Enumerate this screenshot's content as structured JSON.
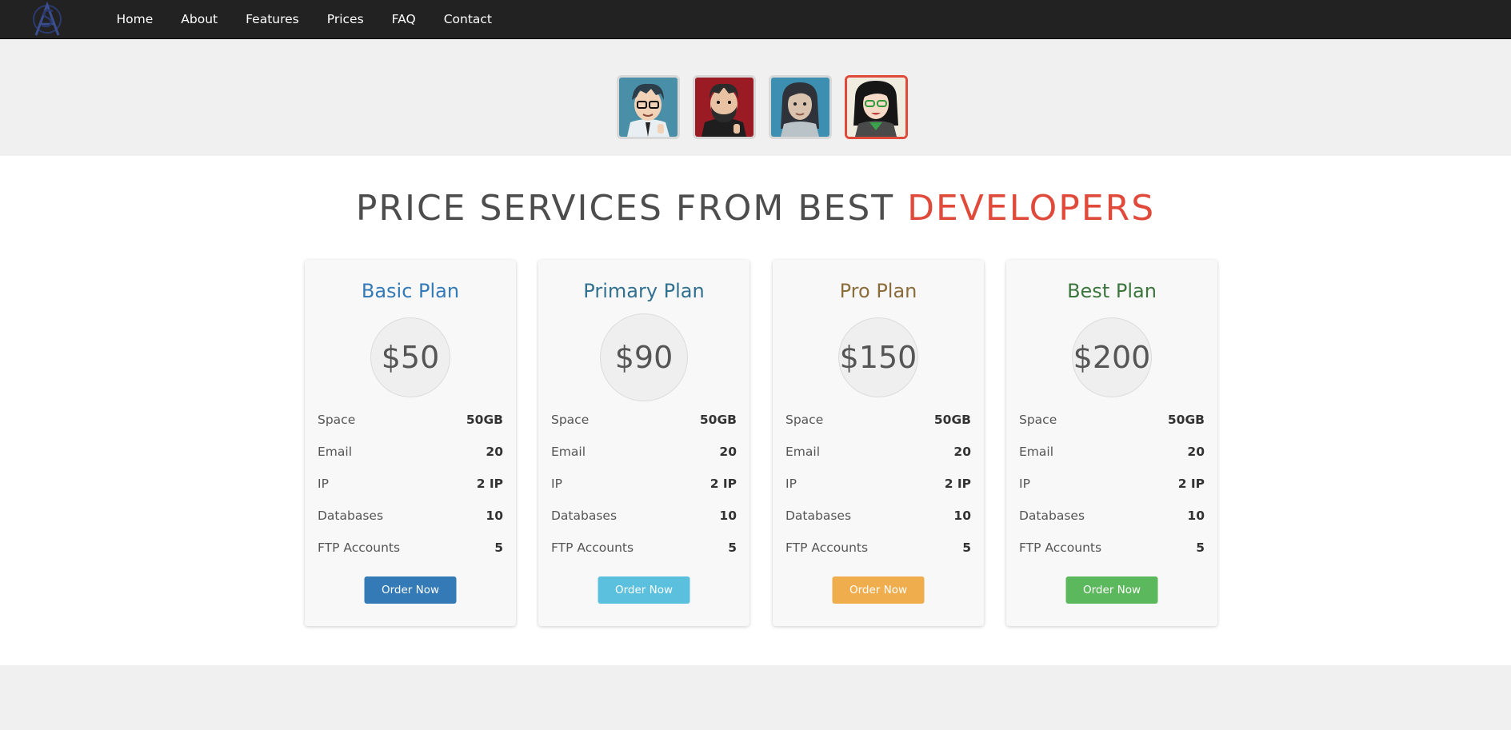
{
  "nav": {
    "items": [
      {
        "label": "Home"
      },
      {
        "label": "About"
      },
      {
        "label": "Features"
      },
      {
        "label": "Prices"
      },
      {
        "label": "FAQ"
      },
      {
        "label": "Contact"
      }
    ]
  },
  "team": {
    "active_index": 3,
    "accent_color": "#e04a3a"
  },
  "prices": {
    "title_main": "PRICE SERVICES FROM BEST ",
    "title_accent": "DEVELOPERS",
    "plans": [
      {
        "name": "Basic Plan",
        "price": "$50",
        "name_color": "#337ab7",
        "button_color": "#337ab7",
        "features": [
          {
            "label": "Space",
            "value": "50GB"
          },
          {
            "label": "Email",
            "value": "20"
          },
          {
            "label": "IP",
            "value": "2 IP"
          },
          {
            "label": "Databases",
            "value": "10"
          },
          {
            "label": "FTP Accounts",
            "value": "5"
          }
        ],
        "button_label": "Order Now"
      },
      {
        "name": "Primary Plan",
        "price": "$90",
        "name_color": "#31708f",
        "button_color": "#5bc0de",
        "features": [
          {
            "label": "Space",
            "value": "50GB"
          },
          {
            "label": "Email",
            "value": "20"
          },
          {
            "label": "IP",
            "value": "2 IP"
          },
          {
            "label": "Databases",
            "value": "10"
          },
          {
            "label": "FTP Accounts",
            "value": "5"
          }
        ],
        "button_label": "Order Now"
      },
      {
        "name": "Pro Plan",
        "price": "$150",
        "name_color": "#8a6d3b",
        "button_color": "#f0ad4e",
        "features": [
          {
            "label": "Space",
            "value": "50GB"
          },
          {
            "label": "Email",
            "value": "20"
          },
          {
            "label": "IP",
            "value": "2 IP"
          },
          {
            "label": "Databases",
            "value": "10"
          },
          {
            "label": "FTP Accounts",
            "value": "5"
          }
        ],
        "button_label": "Order Now"
      },
      {
        "name": "Best Plan",
        "price": "$200",
        "name_color": "#3c763d",
        "button_color": "#5cb85c",
        "features": [
          {
            "label": "Space",
            "value": "50GB"
          },
          {
            "label": "Email",
            "value": "20"
          },
          {
            "label": "IP",
            "value": "2 IP"
          },
          {
            "label": "Databases",
            "value": "10"
          },
          {
            "label": "FTP Accounts",
            "value": "5"
          }
        ],
        "button_label": "Order Now"
      }
    ]
  }
}
